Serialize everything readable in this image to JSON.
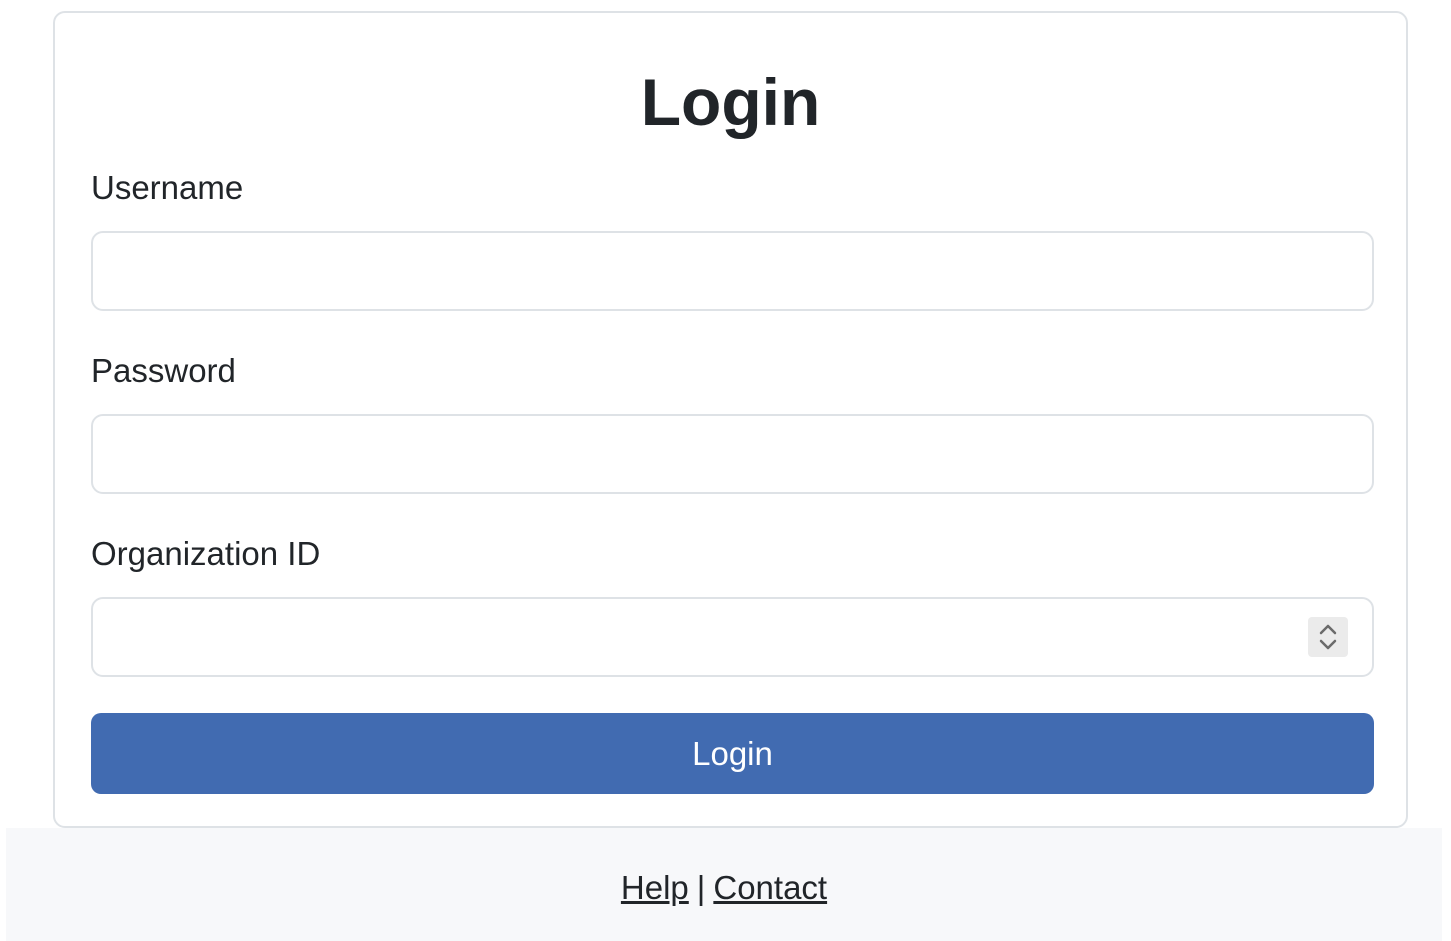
{
  "login_form": {
    "title": "Login",
    "username": {
      "label": "Username",
      "value": "",
      "placeholder": ""
    },
    "password": {
      "label": "Password",
      "value": "",
      "placeholder": ""
    },
    "organization_id": {
      "label": "Organization ID",
      "value": "",
      "placeholder": "",
      "spinner_icon": "up-down-chevron-icon"
    },
    "submit_label": "Login"
  },
  "footer": {
    "help_label": "Help",
    "separator": "|",
    "contact_label": "Contact"
  },
  "colors": {
    "primary_button": "#416bb1",
    "border": "#dee2e6",
    "footer_background": "#f7f8fa",
    "text": "#212529"
  }
}
